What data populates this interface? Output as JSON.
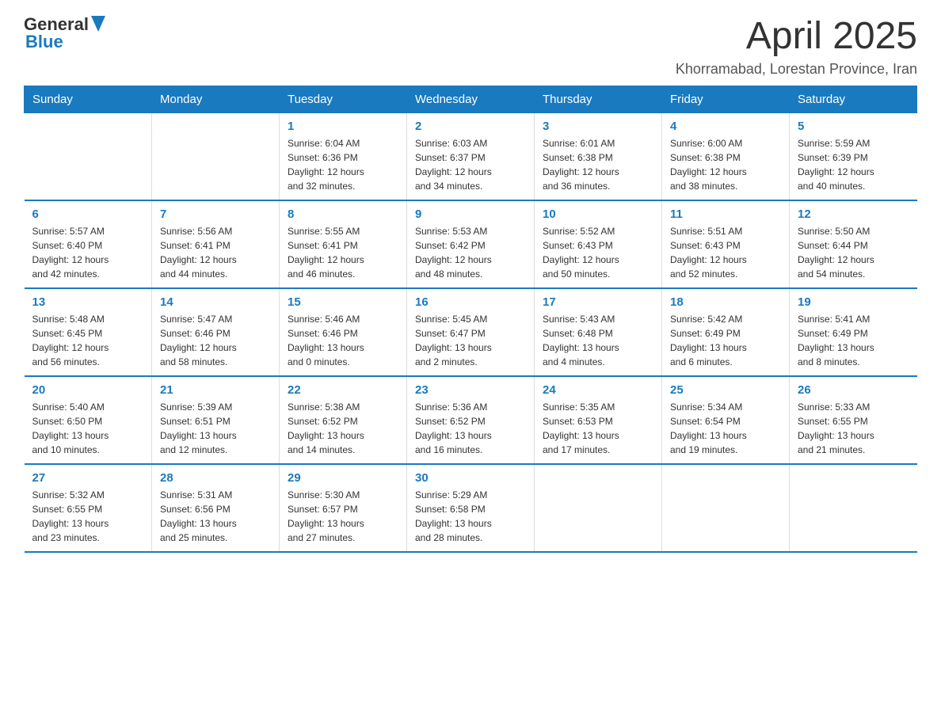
{
  "header": {
    "logo_general": "General",
    "logo_blue": "Blue",
    "title": "April 2025",
    "location": "Khorramabad, Lorestan Province, Iran"
  },
  "weekdays": [
    "Sunday",
    "Monday",
    "Tuesday",
    "Wednesday",
    "Thursday",
    "Friday",
    "Saturday"
  ],
  "weeks": [
    [
      {
        "day": "",
        "info": ""
      },
      {
        "day": "",
        "info": ""
      },
      {
        "day": "1",
        "info": "Sunrise: 6:04 AM\nSunset: 6:36 PM\nDaylight: 12 hours\nand 32 minutes."
      },
      {
        "day": "2",
        "info": "Sunrise: 6:03 AM\nSunset: 6:37 PM\nDaylight: 12 hours\nand 34 minutes."
      },
      {
        "day": "3",
        "info": "Sunrise: 6:01 AM\nSunset: 6:38 PM\nDaylight: 12 hours\nand 36 minutes."
      },
      {
        "day": "4",
        "info": "Sunrise: 6:00 AM\nSunset: 6:38 PM\nDaylight: 12 hours\nand 38 minutes."
      },
      {
        "day": "5",
        "info": "Sunrise: 5:59 AM\nSunset: 6:39 PM\nDaylight: 12 hours\nand 40 minutes."
      }
    ],
    [
      {
        "day": "6",
        "info": "Sunrise: 5:57 AM\nSunset: 6:40 PM\nDaylight: 12 hours\nand 42 minutes."
      },
      {
        "day": "7",
        "info": "Sunrise: 5:56 AM\nSunset: 6:41 PM\nDaylight: 12 hours\nand 44 minutes."
      },
      {
        "day": "8",
        "info": "Sunrise: 5:55 AM\nSunset: 6:41 PM\nDaylight: 12 hours\nand 46 minutes."
      },
      {
        "day": "9",
        "info": "Sunrise: 5:53 AM\nSunset: 6:42 PM\nDaylight: 12 hours\nand 48 minutes."
      },
      {
        "day": "10",
        "info": "Sunrise: 5:52 AM\nSunset: 6:43 PM\nDaylight: 12 hours\nand 50 minutes."
      },
      {
        "day": "11",
        "info": "Sunrise: 5:51 AM\nSunset: 6:43 PM\nDaylight: 12 hours\nand 52 minutes."
      },
      {
        "day": "12",
        "info": "Sunrise: 5:50 AM\nSunset: 6:44 PM\nDaylight: 12 hours\nand 54 minutes."
      }
    ],
    [
      {
        "day": "13",
        "info": "Sunrise: 5:48 AM\nSunset: 6:45 PM\nDaylight: 12 hours\nand 56 minutes."
      },
      {
        "day": "14",
        "info": "Sunrise: 5:47 AM\nSunset: 6:46 PM\nDaylight: 12 hours\nand 58 minutes."
      },
      {
        "day": "15",
        "info": "Sunrise: 5:46 AM\nSunset: 6:46 PM\nDaylight: 13 hours\nand 0 minutes."
      },
      {
        "day": "16",
        "info": "Sunrise: 5:45 AM\nSunset: 6:47 PM\nDaylight: 13 hours\nand 2 minutes."
      },
      {
        "day": "17",
        "info": "Sunrise: 5:43 AM\nSunset: 6:48 PM\nDaylight: 13 hours\nand 4 minutes."
      },
      {
        "day": "18",
        "info": "Sunrise: 5:42 AM\nSunset: 6:49 PM\nDaylight: 13 hours\nand 6 minutes."
      },
      {
        "day": "19",
        "info": "Sunrise: 5:41 AM\nSunset: 6:49 PM\nDaylight: 13 hours\nand 8 minutes."
      }
    ],
    [
      {
        "day": "20",
        "info": "Sunrise: 5:40 AM\nSunset: 6:50 PM\nDaylight: 13 hours\nand 10 minutes."
      },
      {
        "day": "21",
        "info": "Sunrise: 5:39 AM\nSunset: 6:51 PM\nDaylight: 13 hours\nand 12 minutes."
      },
      {
        "day": "22",
        "info": "Sunrise: 5:38 AM\nSunset: 6:52 PM\nDaylight: 13 hours\nand 14 minutes."
      },
      {
        "day": "23",
        "info": "Sunrise: 5:36 AM\nSunset: 6:52 PM\nDaylight: 13 hours\nand 16 minutes."
      },
      {
        "day": "24",
        "info": "Sunrise: 5:35 AM\nSunset: 6:53 PM\nDaylight: 13 hours\nand 17 minutes."
      },
      {
        "day": "25",
        "info": "Sunrise: 5:34 AM\nSunset: 6:54 PM\nDaylight: 13 hours\nand 19 minutes."
      },
      {
        "day": "26",
        "info": "Sunrise: 5:33 AM\nSunset: 6:55 PM\nDaylight: 13 hours\nand 21 minutes."
      }
    ],
    [
      {
        "day": "27",
        "info": "Sunrise: 5:32 AM\nSunset: 6:55 PM\nDaylight: 13 hours\nand 23 minutes."
      },
      {
        "day": "28",
        "info": "Sunrise: 5:31 AM\nSunset: 6:56 PM\nDaylight: 13 hours\nand 25 minutes."
      },
      {
        "day": "29",
        "info": "Sunrise: 5:30 AM\nSunset: 6:57 PM\nDaylight: 13 hours\nand 27 minutes."
      },
      {
        "day": "30",
        "info": "Sunrise: 5:29 AM\nSunset: 6:58 PM\nDaylight: 13 hours\nand 28 minutes."
      },
      {
        "day": "",
        "info": ""
      },
      {
        "day": "",
        "info": ""
      },
      {
        "day": "",
        "info": ""
      }
    ]
  ]
}
